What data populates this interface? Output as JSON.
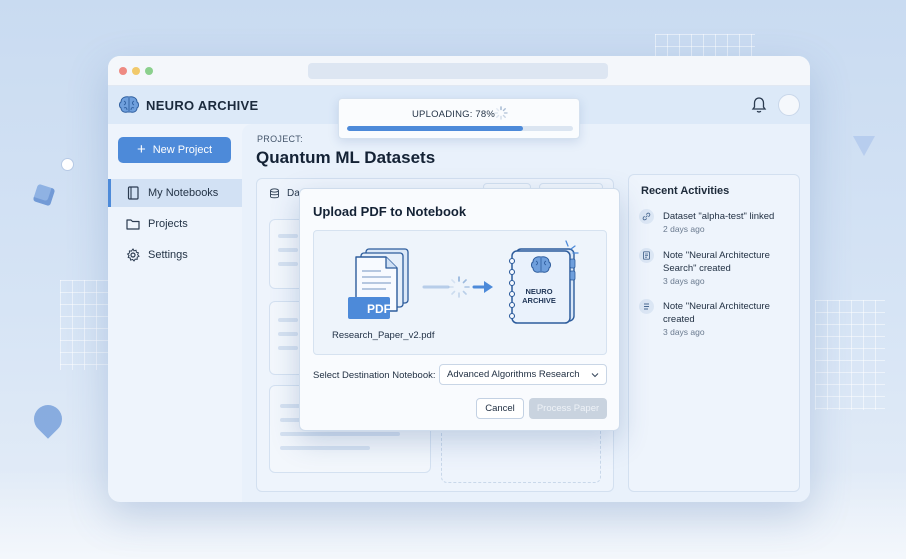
{
  "app": {
    "brand_name": "NEURO ARCHIVE",
    "brand_icon": "brain-icon"
  },
  "header": {
    "notification_icon": "bell-icon",
    "avatar_icon": "avatar"
  },
  "upload": {
    "label": "UPLOADING: 78%",
    "progress": 0.78
  },
  "sidebar": {
    "new_project_label": "New Project",
    "items": [
      {
        "label": "My Notebooks",
        "icon": "notebook-icon",
        "active": true
      },
      {
        "label": "Projects",
        "icon": "folder-icon",
        "active": false
      },
      {
        "label": "Settings",
        "icon": "gear-icon",
        "active": false
      }
    ]
  },
  "project": {
    "label": "PROJECT:",
    "title": "Quantum ML Datasets",
    "panel_tab_partial": "Da"
  },
  "activities": {
    "title": "Recent Activities",
    "items": [
      {
        "text": "Dataset \"alpha-test\" linked",
        "time": "2 days ago",
        "icon": "link-icon"
      },
      {
        "text": "Note \"Neural Architecture Search\" created",
        "time": "3 days ago",
        "icon": "document-icon"
      },
      {
        "text": "Note \"Neural Architecture created",
        "time": "3 days ago",
        "icon": "list-icon"
      }
    ]
  },
  "modal": {
    "title": "Upload PDF to Notebook",
    "pdf_badge": "PDF",
    "file_name": "Research_Paper_v2.pdf",
    "notebook_label_line1": "NEURO",
    "notebook_label_line2": "ARCHIVE",
    "select_label": "Select Destination Notebook:",
    "select_value": "Advanced Algorithms Research",
    "cancel_label": "Cancel",
    "process_label": "Process Paper"
  },
  "colors": {
    "accent": "#4d8ad9",
    "disabled_button": "#c9d3df"
  }
}
